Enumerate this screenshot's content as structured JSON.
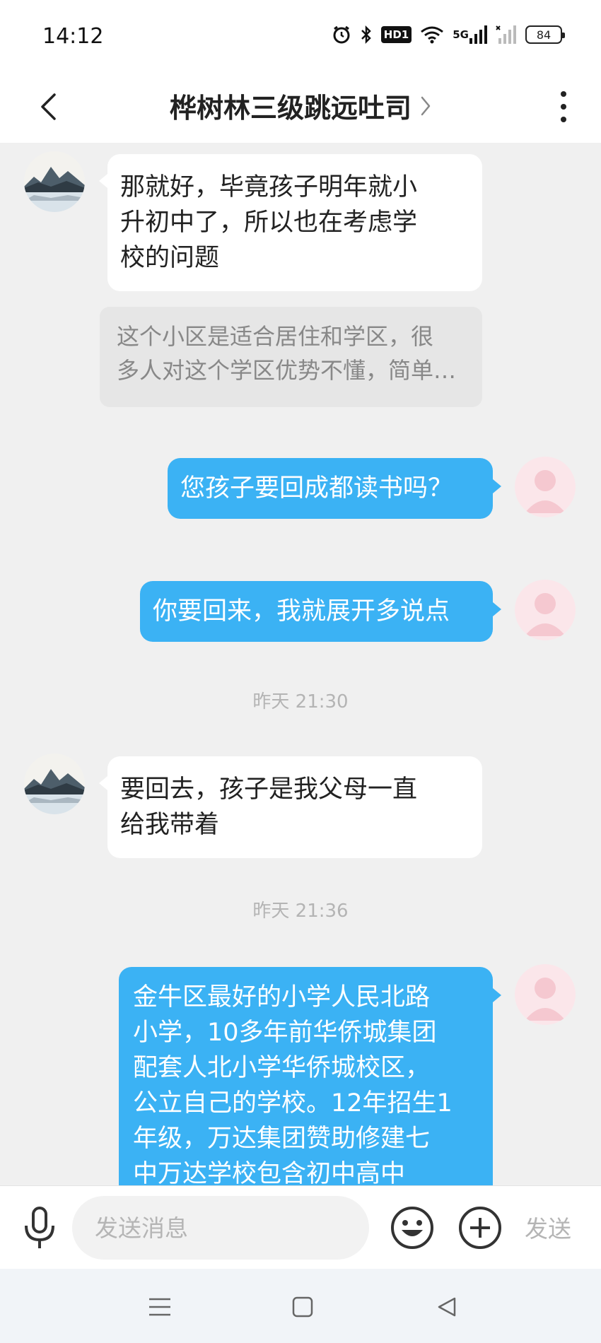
{
  "status_bar": {
    "time": "14:12",
    "battery": "84",
    "hd_label": "HD1",
    "signal_label": "5G",
    "icons": [
      "alarm-icon",
      "bluetooth-icon",
      "hd-icon",
      "wifi-icon",
      "signal-5g-icon",
      "signal-icon",
      "battery-icon"
    ]
  },
  "header": {
    "title": "桦树林三级跳远吐司",
    "back_icon": "chevron-left-icon",
    "more_icon": "more-vertical-icon"
  },
  "messages": [
    {
      "direction": "in",
      "text_lines": [
        "那就好，毕竟孩子明年就小",
        "升初中了，所以也在考虑学",
        "校的问题"
      ]
    },
    {
      "type": "quote",
      "text_lines": [
        "这个小区是适合居住和学区，很",
        "多人对这个学区优势不懂，简单…"
      ]
    },
    {
      "direction": "out",
      "text": "您孩子要回成都读书吗？"
    },
    {
      "direction": "out",
      "text": "你要回来，我就展开多说点"
    },
    {
      "type": "timestamp",
      "text": "昨天 21:30"
    },
    {
      "direction": "in",
      "text_lines": [
        "要回去，孩子是我父母一直",
        "给我带着"
      ]
    },
    {
      "type": "timestamp",
      "text": "昨天 21:36"
    },
    {
      "direction": "out",
      "text_lines": [
        "金牛区最好的小学人民北路",
        "小学，10多年前华侨城集团",
        "配套人北小学华侨城校区，",
        "公立自己的学校。12年招生1",
        "年级，万达集团赞助修建七",
        "中万达学校包含初中高中"
      ]
    }
  ],
  "input_bar": {
    "placeholder": "发送消息",
    "send_label": "发送",
    "icons": [
      "microphone-icon",
      "emoji-icon",
      "plus-circle-icon"
    ]
  },
  "nav_bar": {
    "icons": [
      "menu-icon",
      "home-square-icon",
      "back-triangle-icon"
    ]
  },
  "colors": {
    "outgoing_bubble": "#3bb2f4",
    "incoming_bubble": "#ffffff",
    "chat_background": "#f0f0f0",
    "quote_background": "#e6e6e6",
    "timestamp_text": "#b4b4b4"
  }
}
